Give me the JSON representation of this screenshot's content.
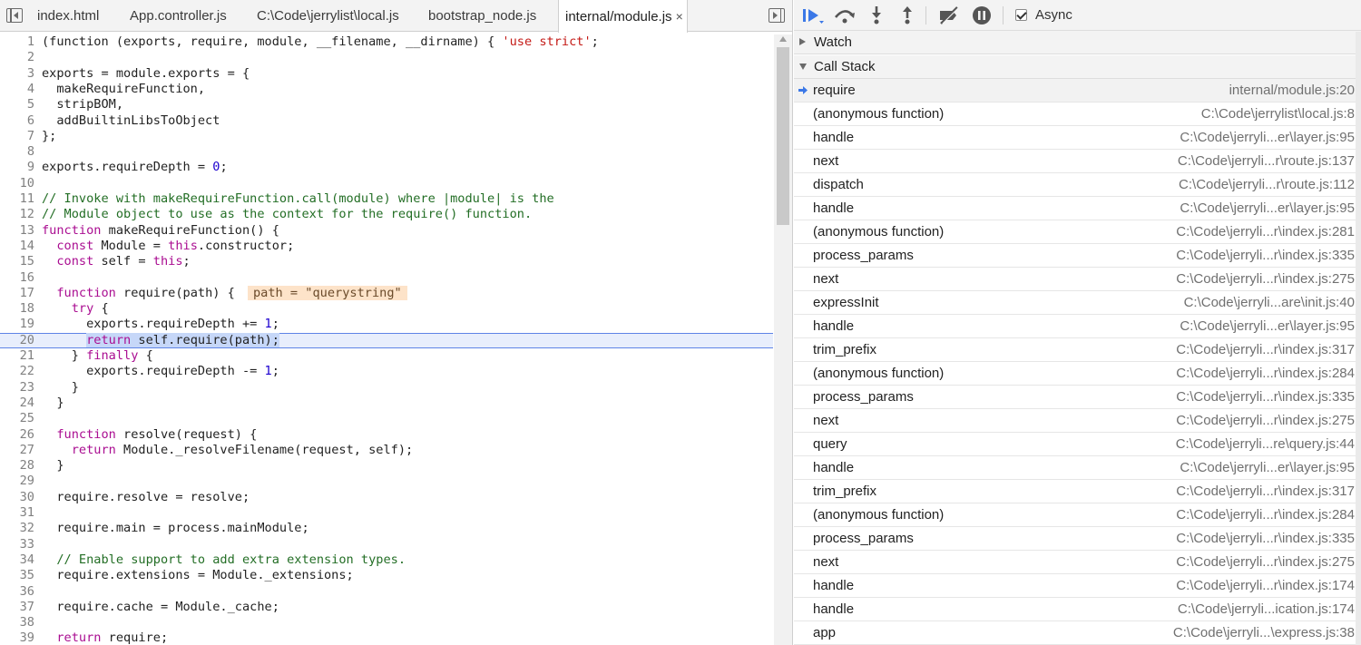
{
  "tabs": [
    {
      "label": "index.html"
    },
    {
      "label": "App.controller.js"
    },
    {
      "label": "C:\\Code\\jerrylist\\local.js"
    },
    {
      "label": "bootstrap_node.js"
    },
    {
      "label": "internal/module.js",
      "close": "×"
    }
  ],
  "code": {
    "current_line": 20,
    "inline_value": "path = \"querystring\"",
    "lines": [
      {
        "n": "1"
      },
      {
        "n": "2"
      },
      {
        "n": "3"
      },
      {
        "n": "4"
      },
      {
        "n": "5"
      },
      {
        "n": "6"
      },
      {
        "n": "7"
      },
      {
        "n": "8"
      },
      {
        "n": "9"
      },
      {
        "n": "10"
      },
      {
        "n": "11"
      },
      {
        "n": "12"
      },
      {
        "n": "13"
      },
      {
        "n": "14"
      },
      {
        "n": "15"
      },
      {
        "n": "16"
      },
      {
        "n": "17"
      },
      {
        "n": "18"
      },
      {
        "n": "19"
      },
      {
        "n": "20"
      },
      {
        "n": "21"
      },
      {
        "n": "22"
      },
      {
        "n": "23"
      },
      {
        "n": "24"
      },
      {
        "n": "25"
      },
      {
        "n": "26"
      },
      {
        "n": "27"
      },
      {
        "n": "28"
      },
      {
        "n": "29"
      },
      {
        "n": "30"
      },
      {
        "n": "31"
      },
      {
        "n": "32"
      },
      {
        "n": "33"
      },
      {
        "n": "34"
      },
      {
        "n": "35"
      },
      {
        "n": "36"
      },
      {
        "n": "37"
      },
      {
        "n": "38"
      },
      {
        "n": "39"
      }
    ],
    "text": {
      "l1": "(function (exports, require, module, __filename, __dirname) { ",
      "l1b": "'use strict'",
      "l1c": ";",
      "l3": "exports = module.exports = {",
      "l4": "  makeRequireFunction,",
      "l5": "  stripBOM,",
      "l6": "  addBuiltinLibsToObject",
      "l7": "};",
      "l9a": "exports.requireDepth = ",
      "l9b": "0",
      "l9c": ";",
      "l11": "// Invoke with makeRequireFunction.call(module) where |module| is the",
      "l12": "// Module object to use as the context for the require() function.",
      "l13a": "function",
      "l13b": " makeRequireFunction() {",
      "l14a": "  ",
      "l14b": "const",
      "l14c": " Module = ",
      "l14d": "this",
      "l14e": ".constructor;",
      "l15a": "  ",
      "l15b": "const",
      "l15c": " self = ",
      "l15d": "this",
      "l15e": ";",
      "l17a": "  ",
      "l17b": "function",
      "l17c": " require(path) { ",
      "l18a": "    ",
      "l18b": "try",
      "l18c": " {",
      "l19a": "      exports.requireDepth += ",
      "l19b": "1",
      "l19c": ";",
      "l20a": "      ",
      "l20b": "return",
      "l20c": " self.require(path);",
      "l21a": "    } ",
      "l21b": "finally",
      "l21c": " {",
      "l22a": "      exports.requireDepth -= ",
      "l22b": "1",
      "l22c": ";",
      "l23": "    }",
      "l24": "  }",
      "l26a": "  ",
      "l26b": "function",
      "l26c": " resolve(request) {",
      "l27a": "    ",
      "l27b": "return",
      "l27c": " Module._resolveFilename(request, self);",
      "l28": "  }",
      "l30": "  require.resolve = resolve;",
      "l32": "  require.main = process.mainModule;",
      "l34": "  // Enable support to add extra extension types.",
      "l35": "  require.extensions = Module._extensions;",
      "l37": "  require.cache = Module._cache;",
      "l39a": "  ",
      "l39b": "return",
      "l39c": " require;"
    }
  },
  "toolbar": {
    "async_label": "Async",
    "async_checked": true,
    "buttons": [
      "resume-icon",
      "step-over-icon",
      "step-into-icon",
      "step-out-icon",
      "deactivate-breakpoints-icon",
      "pause-on-exceptions-icon"
    ],
    "accent": "#3b78e7"
  },
  "sidebar": {
    "watch_label": "Watch",
    "callstack_label": "Call Stack"
  },
  "call_stack": [
    {
      "fn": "require",
      "loc": "internal/module.js:20",
      "selected": true
    },
    {
      "fn": "(anonymous function)",
      "loc": "C:\\Code\\jerrylist\\local.js:8"
    },
    {
      "fn": "handle",
      "loc": "C:\\Code\\jerryli...er\\layer.js:95"
    },
    {
      "fn": "next",
      "loc": "C:\\Code\\jerryli...r\\route.js:137"
    },
    {
      "fn": "dispatch",
      "loc": "C:\\Code\\jerryli...r\\route.js:112"
    },
    {
      "fn": "handle",
      "loc": "C:\\Code\\jerryli...er\\layer.js:95"
    },
    {
      "fn": "(anonymous function)",
      "loc": "C:\\Code\\jerryli...r\\index.js:281"
    },
    {
      "fn": "process_params",
      "loc": "C:\\Code\\jerryli...r\\index.js:335"
    },
    {
      "fn": "next",
      "loc": "C:\\Code\\jerryli...r\\index.js:275"
    },
    {
      "fn": "expressInit",
      "loc": "C:\\Code\\jerryli...are\\init.js:40"
    },
    {
      "fn": "handle",
      "loc": "C:\\Code\\jerryli...er\\layer.js:95"
    },
    {
      "fn": "trim_prefix",
      "loc": "C:\\Code\\jerryli...r\\index.js:317"
    },
    {
      "fn": "(anonymous function)",
      "loc": "C:\\Code\\jerryli...r\\index.js:284"
    },
    {
      "fn": "process_params",
      "loc": "C:\\Code\\jerryli...r\\index.js:335"
    },
    {
      "fn": "next",
      "loc": "C:\\Code\\jerryli...r\\index.js:275"
    },
    {
      "fn": "query",
      "loc": "C:\\Code\\jerryli...re\\query.js:44"
    },
    {
      "fn": "handle",
      "loc": "C:\\Code\\jerryli...er\\layer.js:95"
    },
    {
      "fn": "trim_prefix",
      "loc": "C:\\Code\\jerryli...r\\index.js:317"
    },
    {
      "fn": "(anonymous function)",
      "loc": "C:\\Code\\jerryli...r\\index.js:284"
    },
    {
      "fn": "process_params",
      "loc": "C:\\Code\\jerryli...r\\index.js:335"
    },
    {
      "fn": "next",
      "loc": "C:\\Code\\jerryli...r\\index.js:275"
    },
    {
      "fn": "handle",
      "loc": "C:\\Code\\jerryli...r\\index.js:174"
    },
    {
      "fn": "handle",
      "loc": "C:\\Code\\jerryli...ication.js:174"
    },
    {
      "fn": "app",
      "loc": "C:\\Code\\jerryli...\\express.js:38"
    }
  ]
}
